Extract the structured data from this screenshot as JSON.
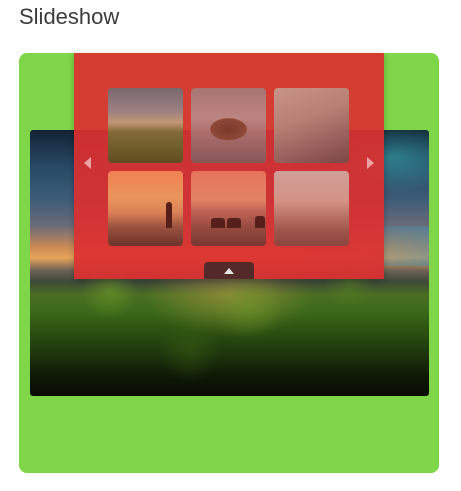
{
  "page": {
    "title": "Slideshow"
  },
  "slideshow": {
    "background_color": "#7ed648",
    "panel_color": "#dc3030",
    "thumbnails": [
      {
        "icon": "thumbnail-image"
      },
      {
        "icon": "thumbnail-image"
      },
      {
        "icon": "thumbnail-image"
      },
      {
        "icon": "thumbnail-image"
      },
      {
        "icon": "thumbnail-image"
      },
      {
        "icon": "thumbnail-image"
      }
    ],
    "controls": {
      "prev_icon": "chevron-left-icon",
      "next_icon": "chevron-right-icon",
      "toggle_icon": "chevron-up-icon"
    }
  }
}
